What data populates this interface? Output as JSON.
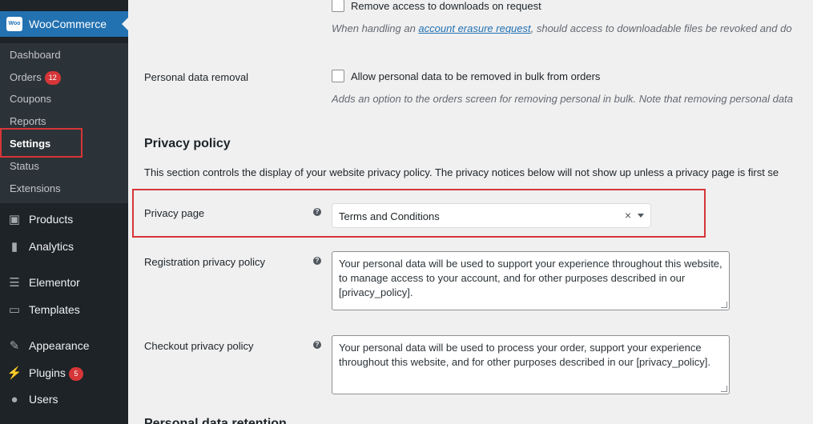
{
  "sidebar": {
    "woocommerce": {
      "title": "WooCommerce",
      "logo_text": "Woo"
    },
    "submenu": [
      {
        "label": "Dashboard"
      },
      {
        "label": "Orders",
        "badge": "12"
      },
      {
        "label": "Coupons"
      },
      {
        "label": "Reports"
      },
      {
        "label": "Settings"
      },
      {
        "label": "Status"
      },
      {
        "label": "Extensions"
      }
    ],
    "menu": [
      {
        "label": "Products",
        "icon": "products-icon"
      },
      {
        "label": "Analytics",
        "icon": "analytics-icon"
      },
      {
        "label": "Elementor",
        "icon": "elementor-icon"
      },
      {
        "label": "Templates",
        "icon": "templates-icon"
      },
      {
        "label": "Appearance",
        "icon": "appearance-icon"
      },
      {
        "label": "Plugins",
        "icon": "plugins-icon",
        "badge": "5"
      },
      {
        "label": "Users",
        "icon": "users-icon"
      }
    ]
  },
  "content": {
    "remove_downloads": {
      "checkbox_label": "Remove access to downloads on request",
      "desc_prefix": "When handling an ",
      "desc_link": "account erasure request",
      "desc_suffix": ", should access to downloadable files be revoked and do"
    },
    "personal_data_removal": {
      "label": "Personal data removal",
      "checkbox_label": "Allow personal data to be removed in bulk from orders",
      "desc": "Adds an option to the orders screen for removing personal in bulk. Note that removing personal data"
    },
    "privacy_policy": {
      "heading": "Privacy policy",
      "description": "This section controls the display of your website privacy policy. The privacy notices below will not show up unless a privacy page is first se"
    },
    "privacy_page": {
      "label": "Privacy page",
      "selected": "Terms and Conditions",
      "clear": "×"
    },
    "registration_policy": {
      "label": "Registration privacy policy",
      "value": "Your personal data will be used to support your experience throughout this website, to manage access to your account, and for other purposes described in our [privacy_policy]."
    },
    "checkout_policy": {
      "label": "Checkout privacy policy",
      "value": "Your personal data will be used to process your order, support your experience throughout this website, and for other purposes described in our [privacy_policy]."
    },
    "next_heading": "Personal data retention"
  }
}
